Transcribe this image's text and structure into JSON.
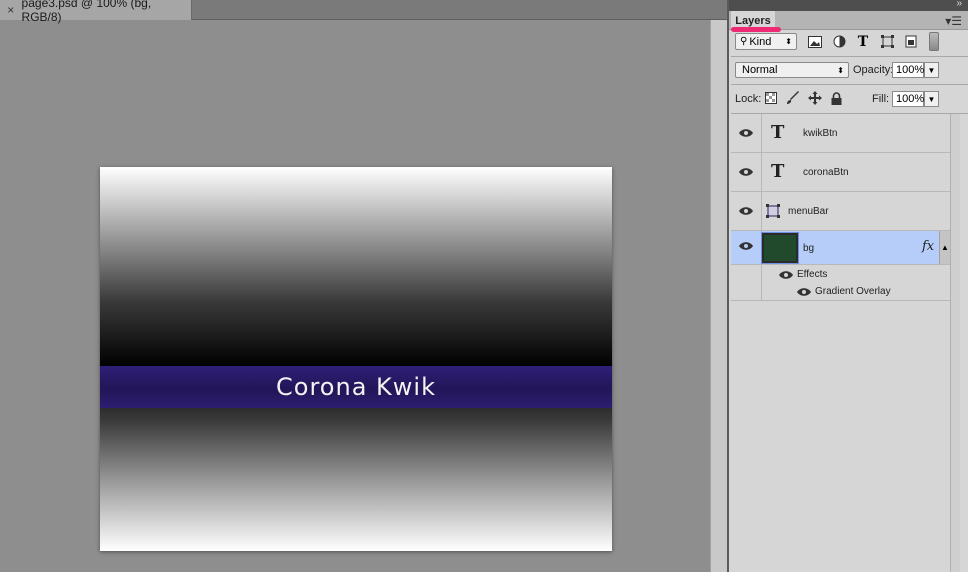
{
  "document": {
    "tab_close": "×",
    "tab_title": "page3.psd @ 100% (bg, RGB/8)",
    "canvas_text": "Corona Kwik"
  },
  "panel": {
    "tab": "Layers",
    "filter": {
      "kind_label": "Kind"
    },
    "blend_mode": "Normal",
    "opacity_label": "Opacity:",
    "opacity_value": "100%",
    "lock_label": "Lock:",
    "fill_label": "Fill:",
    "fill_value": "100%",
    "layers": [
      {
        "name": "kwikBtn",
        "type": "text",
        "thumb": "T"
      },
      {
        "name": "coronaBtn",
        "type": "text",
        "thumb": "T"
      },
      {
        "name": "menuBar",
        "type": "shape"
      },
      {
        "name": "bg",
        "type": "pixel",
        "selected": true,
        "fx": "fx"
      }
    ],
    "effects_label": "Effects",
    "effect_items": [
      "Gradient Overlay"
    ]
  },
  "colors": {
    "accent_selection": "#b5cdf8",
    "menubar_band": "#2a1b68",
    "bg_thumb": "#214a2c",
    "tab_underline": "#ee2a74"
  }
}
